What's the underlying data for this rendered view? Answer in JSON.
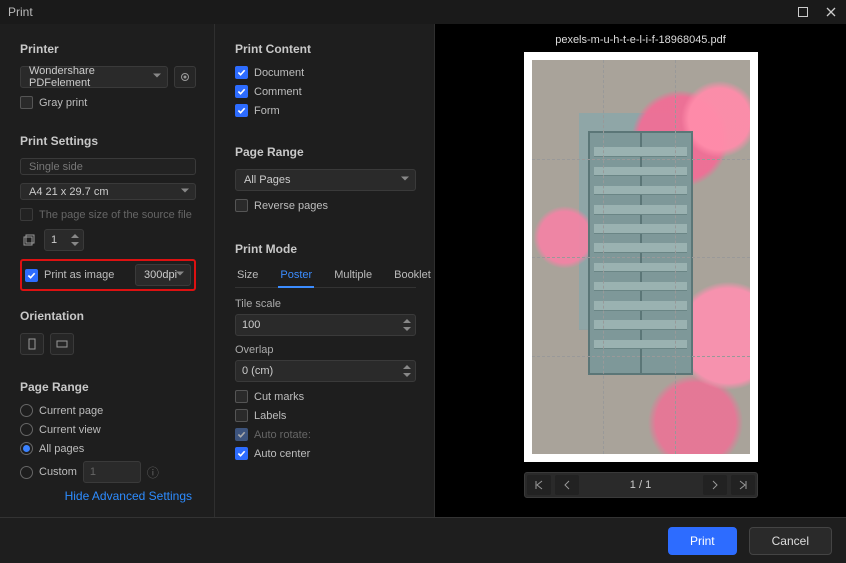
{
  "window": {
    "title": "Print"
  },
  "left": {
    "printer_title": "Printer",
    "printer_selected": "Wondershare PDFelement",
    "gray_print": "Gray print",
    "settings_title": "Print Settings",
    "single_placeholder": "Single side",
    "paper_size": "A4 21 x 29.7 cm",
    "source_size_label": "The page size of the source file",
    "copies_value": "1",
    "print_as_image": "Print as image",
    "dpi_value": "300dpi",
    "orientation_title": "Orientation",
    "page_range_title": "Page Range",
    "range": {
      "current_page": "Current page",
      "current_view": "Current view",
      "all_pages": "All pages",
      "custom": "Custom"
    },
    "custom_range_value": "1",
    "advanced_link": "Hide Advanced Settings"
  },
  "mid": {
    "content_title": "Print Content",
    "doc": "Document",
    "comment": "Comment",
    "form": "Form",
    "page_range_title": "Page Range",
    "all_pages": "All Pages",
    "reverse": "Reverse pages",
    "mode_title": "Print Mode",
    "tabs": {
      "size": "Size",
      "poster": "Poster",
      "multiple": "Multiple",
      "booklet": "Booklet"
    },
    "tile_scale_label": "Tile scale",
    "tile_scale_value": "100",
    "overlap_label": "Overlap",
    "overlap_value": "0  (cm)",
    "cut_marks": "Cut marks",
    "labels": "Labels",
    "auto_rotate": "Auto rotate:",
    "auto_center": "Auto center"
  },
  "right": {
    "filename": "pexels-m-u-h-t-e-l-i-f-18968045.pdf",
    "page_indicator": "1 / 1"
  },
  "footer": {
    "print": "Print",
    "cancel": "Cancel"
  }
}
